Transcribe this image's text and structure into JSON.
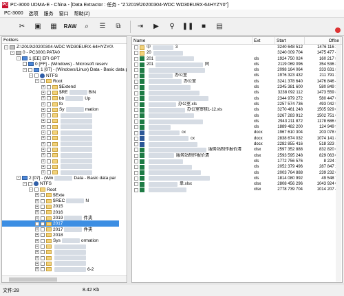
{
  "window": {
    "title": "PC-3000 UDMA-E - China - [Data Extractor : 任务 - \"Z:\\2019\\20200304-WDC WD30EURX-64HYZY0\"]",
    "app_icon": "PC"
  },
  "menu": [
    "PC-3000",
    "选项",
    "服务",
    "窗口",
    "帮助(Z)"
  ],
  "toolbar": {
    "raw_label": "RAW"
  },
  "left_panel": {
    "header": "Folders",
    "tree": [
      {
        "label": "Z:\\2019\\20200304-WDC WD30EURX-64HYZY0\\",
        "icon": "disk",
        "level": 0,
        "exp": "-"
      },
      {
        "label": "0 - PC3000.PATA0",
        "icon": "disk",
        "level": 1,
        "exp": "-"
      },
      {
        "label": "1 [EE] EFI GPT",
        "icon": "part",
        "level": 2,
        "exp": "-"
      },
      {
        "label": "0 [FF] - (Windows) - Microsoft reserv",
        "icon": "part",
        "level": 3,
        "exp": ""
      },
      {
        "label": "1 [07] - (Windows/Linux) Data - Basic data par",
        "icon": "part",
        "level": 3,
        "exp": "-"
      },
      {
        "label": "NTFS",
        "icon": "ntfs",
        "level": 4,
        "exp": "-"
      },
      {
        "label": "Root",
        "icon": "folder",
        "level": 5,
        "exp": "-"
      },
      {
        "label": "$Extend",
        "icon": "folder",
        "level": 6,
        "exp": "+"
      },
      {
        "label": "$RE",
        "icon": "folder",
        "level": 6,
        "exp": "+",
        "suffix": "BIN"
      },
      {
        "label": "bb",
        "icon": "folder",
        "level": 6,
        "exp": "+",
        "suffix": "Up"
      },
      {
        "label": "fo",
        "icon": "folder",
        "level": 6,
        "exp": "+"
      },
      {
        "label": "Sy",
        "icon": "folder",
        "level": 6,
        "exp": "+",
        "suffix": "mation"
      },
      {
        "label": "",
        "icon": "folder",
        "level": 6,
        "exp": "+"
      },
      {
        "label": "",
        "icon": "folder",
        "level": 6,
        "exp": "+"
      },
      {
        "label": "",
        "icon": "folder",
        "level": 6,
        "exp": "+"
      },
      {
        "label": "",
        "icon": "folder",
        "level": 6,
        "exp": "+"
      },
      {
        "label": "",
        "icon": "folder",
        "level": 6,
        "exp": "+"
      },
      {
        "label": "",
        "icon": "folder",
        "level": 6,
        "exp": "+"
      },
      {
        "label": "",
        "icon": "folder",
        "level": 6,
        "exp": "+"
      },
      {
        "label": "",
        "icon": "folder",
        "level": 6,
        "exp": "+"
      },
      {
        "label": "",
        "icon": "folder",
        "level": 6,
        "exp": "+"
      },
      {
        "label": "",
        "icon": "folder",
        "level": 6,
        "exp": "+"
      },
      {
        "label": "",
        "icon": "folder",
        "level": 6,
        "exp": "+"
      },
      {
        "label": "2 [07] - (Win",
        "icon": "part",
        "level": 2,
        "exp": "-",
        "suffix": "Data - Basic data par"
      },
      {
        "label": "NTFS",
        "icon": "ntfs",
        "level": 3,
        "exp": "-"
      },
      {
        "label": "Root",
        "icon": "folder",
        "level": 4,
        "exp": "-"
      },
      {
        "label": "$Exte",
        "icon": "folder",
        "level": 5,
        "exp": "+"
      },
      {
        "label": "$REC",
        "icon": "folder",
        "level": 5,
        "exp": "+",
        "suffix": "N"
      },
      {
        "label": "2015",
        "icon": "folder",
        "level": 5,
        "exp": "+"
      },
      {
        "label": "2016",
        "icon": "folder",
        "level": 5,
        "exp": "+"
      },
      {
        "label": "2019",
        "icon": "folder",
        "level": 5,
        "exp": "+",
        "suffix": "件夹"
      },
      {
        "label": "2017",
        "icon": "folder",
        "level": 5,
        "exp": "+",
        "selected": true
      },
      {
        "label": "2017",
        "icon": "folder",
        "level": 5,
        "exp": "+",
        "suffix": "件夹"
      },
      {
        "label": "2018",
        "icon": "folder",
        "level": 5,
        "exp": "+"
      },
      {
        "label": "Sys",
        "icon": "folder",
        "level": 5,
        "exp": "+",
        "suffix": "ormation"
      },
      {
        "label": "",
        "icon": "folder",
        "level": 5,
        "exp": "+"
      },
      {
        "label": "",
        "icon": "folder",
        "level": 5,
        "exp": "+"
      },
      {
        "label": "",
        "icon": "folder",
        "level": 5,
        "exp": "+"
      },
      {
        "label": "",
        "icon": "folder",
        "level": 5,
        "exp": "+"
      },
      {
        "label": "",
        "icon": "folder",
        "level": 5,
        "exp": "+",
        "suffix": "6-2"
      }
    ]
  },
  "right_panel": {
    "columns": [
      "Name",
      "Ext",
      "Start",
      "Offse"
    ],
    "rows": [
      {
        "icon": "fold",
        "name": "中",
        "ext": "",
        "start": "3240 648 512",
        "offset": "1476 116 28"
      },
      {
        "icon": "fold",
        "name": "20",
        "ext": "",
        "start": "3240 009 704",
        "offset": "1475 477 48"
      },
      {
        "icon": "xls",
        "name": "201",
        "ext": "xls",
        "start": "1924 750 024",
        "offset": "160 217 80"
      },
      {
        "icon": "xls",
        "name": "201",
        "ext": "xls",
        "start": "2119 069 096",
        "offset": "354 536 87"
      },
      {
        "icon": "xls",
        "name": "",
        "ext": "xls",
        "start": "2098 164 064",
        "offset": "333 631 84"
      },
      {
        "icon": "xls",
        "name": "",
        "ext": "xls",
        "start": "1976 323 432",
        "offset": "211 791 20"
      },
      {
        "icon": "xls",
        "name": "",
        "ext": "xls",
        "start": "3241 378 640",
        "offset": "1476 846 41"
      },
      {
        "icon": "xls",
        "name": "",
        "ext": "xls",
        "start": "2345 381 600",
        "offset": "580 849 38"
      },
      {
        "icon": "xls",
        "name": "",
        "ext": "xls",
        "start": "3238 092 112",
        "offset": "1473 559 88"
      },
      {
        "icon": "xls",
        "name": "",
        "ext": "xls",
        "start": "2344 979 272",
        "offset": "580 447 04"
      },
      {
        "icon": "xls",
        "name": "",
        "ext": "xls",
        "start": "2257 574 736",
        "offset": "493 042 51"
      },
      {
        "icon": "xls",
        "name": "",
        "ext": "xls",
        "start": "3270 461 248",
        "offset": "1505 929 02"
      },
      {
        "icon": "xls",
        "name": "",
        "ext": "xls",
        "start": "3267 283 912",
        "offset": "1502 751 68"
      },
      {
        "icon": "xls",
        "name": "",
        "ext": "xls",
        "start": "2943 211 872",
        "offset": "1178 686 04"
      },
      {
        "icon": "xls",
        "name": "",
        "ext": "xls",
        "start": "1889 482 200",
        "offset": "124 949 97"
      },
      {
        "icon": "doc",
        "name": "",
        "ext": "docx",
        "start": "1967 610 304",
        "offset": "203 078 07"
      },
      {
        "icon": "doc",
        "name": "",
        "ext": "docx",
        "start": "2838 674 032",
        "offset": "1074 141 80"
      },
      {
        "icon": "doc",
        "name": "",
        "ext": "docx",
        "start": "2282 855 416",
        "offset": "518 323 19"
      },
      {
        "icon": "xls",
        "name": "",
        "ext": "xlsx",
        "start": "2597 352 888",
        "offset": "832 820 66"
      },
      {
        "icon": "xls",
        "name": "",
        "ext": "xlsx",
        "start": "2593 595 248",
        "offset": "829 063 02"
      },
      {
        "icon": "xls",
        "name": "",
        "ext": "xls",
        "start": "1772 756 576",
        "offset": "8 224 35"
      },
      {
        "icon": "xls",
        "name": "",
        "ext": "xls",
        "start": "2052 379 496",
        "offset": "287 847 27"
      },
      {
        "icon": "xls",
        "name": "",
        "ext": "xls",
        "start": "2003 764 888",
        "offset": "239 232 66"
      },
      {
        "icon": "xls",
        "name": "",
        "ext": "xls",
        "start": "1814 080 992",
        "offset": "49 548 76"
      },
      {
        "icon": "xls",
        "name": "",
        "ext": "xlsx",
        "start": "2808 456 296",
        "offset": "1043 924 07"
      },
      {
        "icon": "xls",
        "name": "",
        "ext": "xlsx",
        "start": "2778 739 704",
        "offset": "1014 207 48"
      }
    ],
    "visible_name_fragments": [
      "3",
      "同",
      "办公室",
      "办公室.xls",
      "办公室审核1-12.xls",
      "cx",
      "cx",
      "服务站制作报价清",
      "服务站制作报价清",
      "单.xlsx"
    ]
  },
  "status": {
    "count": "文件:28",
    "size": "8.42 Kb"
  },
  "colors": {
    "selection": "#3c8ee3",
    "folder": "#f2d27a",
    "excel": "#1e7b45",
    "word": "#2b5797"
  }
}
